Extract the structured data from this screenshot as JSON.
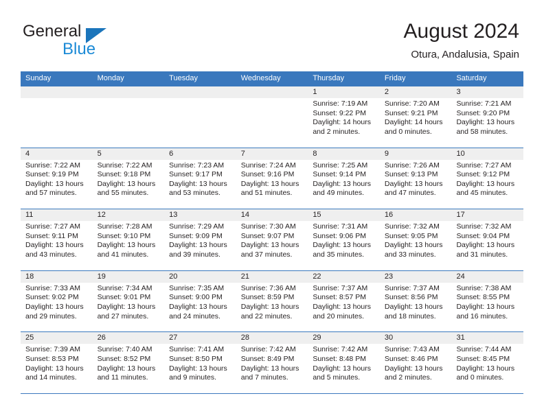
{
  "brand": {
    "name_part1": "General",
    "name_part2": "Blue",
    "triangle_color": "#1b75bb",
    "blue_text_color": "#1b8ad6"
  },
  "header": {
    "title": "August 2024",
    "subtitle": "Otura, Andalusia, Spain"
  },
  "theme": {
    "header_row_bg": "#3a78bd",
    "daynum_band_bg": "#efefef",
    "grid_line": "#3a78bd",
    "text": "#231f20"
  },
  "weekdays": [
    "Sunday",
    "Monday",
    "Tuesday",
    "Wednesday",
    "Thursday",
    "Friday",
    "Saturday"
  ],
  "weeks": [
    [
      {
        "day": "",
        "sunrise": "",
        "sunset": "",
        "daylight_line1": "",
        "daylight_line2": ""
      },
      {
        "day": "",
        "sunrise": "",
        "sunset": "",
        "daylight_line1": "",
        "daylight_line2": ""
      },
      {
        "day": "",
        "sunrise": "",
        "sunset": "",
        "daylight_line1": "",
        "daylight_line2": ""
      },
      {
        "day": "",
        "sunrise": "",
        "sunset": "",
        "daylight_line1": "",
        "daylight_line2": ""
      },
      {
        "day": "1",
        "sunrise": "Sunrise: 7:19 AM",
        "sunset": "Sunset: 9:22 PM",
        "daylight_line1": "Daylight: 14 hours",
        "daylight_line2": "and 2 minutes."
      },
      {
        "day": "2",
        "sunrise": "Sunrise: 7:20 AM",
        "sunset": "Sunset: 9:21 PM",
        "daylight_line1": "Daylight: 14 hours",
        "daylight_line2": "and 0 minutes."
      },
      {
        "day": "3",
        "sunrise": "Sunrise: 7:21 AM",
        "sunset": "Sunset: 9:20 PM",
        "daylight_line1": "Daylight: 13 hours",
        "daylight_line2": "and 58 minutes."
      }
    ],
    [
      {
        "day": "4",
        "sunrise": "Sunrise: 7:22 AM",
        "sunset": "Sunset: 9:19 PM",
        "daylight_line1": "Daylight: 13 hours",
        "daylight_line2": "and 57 minutes."
      },
      {
        "day": "5",
        "sunrise": "Sunrise: 7:22 AM",
        "sunset": "Sunset: 9:18 PM",
        "daylight_line1": "Daylight: 13 hours",
        "daylight_line2": "and 55 minutes."
      },
      {
        "day": "6",
        "sunrise": "Sunrise: 7:23 AM",
        "sunset": "Sunset: 9:17 PM",
        "daylight_line1": "Daylight: 13 hours",
        "daylight_line2": "and 53 minutes."
      },
      {
        "day": "7",
        "sunrise": "Sunrise: 7:24 AM",
        "sunset": "Sunset: 9:16 PM",
        "daylight_line1": "Daylight: 13 hours",
        "daylight_line2": "and 51 minutes."
      },
      {
        "day": "8",
        "sunrise": "Sunrise: 7:25 AM",
        "sunset": "Sunset: 9:14 PM",
        "daylight_line1": "Daylight: 13 hours",
        "daylight_line2": "and 49 minutes."
      },
      {
        "day": "9",
        "sunrise": "Sunrise: 7:26 AM",
        "sunset": "Sunset: 9:13 PM",
        "daylight_line1": "Daylight: 13 hours",
        "daylight_line2": "and 47 minutes."
      },
      {
        "day": "10",
        "sunrise": "Sunrise: 7:27 AM",
        "sunset": "Sunset: 9:12 PM",
        "daylight_line1": "Daylight: 13 hours",
        "daylight_line2": "and 45 minutes."
      }
    ],
    [
      {
        "day": "11",
        "sunrise": "Sunrise: 7:27 AM",
        "sunset": "Sunset: 9:11 PM",
        "daylight_line1": "Daylight: 13 hours",
        "daylight_line2": "and 43 minutes."
      },
      {
        "day": "12",
        "sunrise": "Sunrise: 7:28 AM",
        "sunset": "Sunset: 9:10 PM",
        "daylight_line1": "Daylight: 13 hours",
        "daylight_line2": "and 41 minutes."
      },
      {
        "day": "13",
        "sunrise": "Sunrise: 7:29 AM",
        "sunset": "Sunset: 9:09 PM",
        "daylight_line1": "Daylight: 13 hours",
        "daylight_line2": "and 39 minutes."
      },
      {
        "day": "14",
        "sunrise": "Sunrise: 7:30 AM",
        "sunset": "Sunset: 9:07 PM",
        "daylight_line1": "Daylight: 13 hours",
        "daylight_line2": "and 37 minutes."
      },
      {
        "day": "15",
        "sunrise": "Sunrise: 7:31 AM",
        "sunset": "Sunset: 9:06 PM",
        "daylight_line1": "Daylight: 13 hours",
        "daylight_line2": "and 35 minutes."
      },
      {
        "day": "16",
        "sunrise": "Sunrise: 7:32 AM",
        "sunset": "Sunset: 9:05 PM",
        "daylight_line1": "Daylight: 13 hours",
        "daylight_line2": "and 33 minutes."
      },
      {
        "day": "17",
        "sunrise": "Sunrise: 7:32 AM",
        "sunset": "Sunset: 9:04 PM",
        "daylight_line1": "Daylight: 13 hours",
        "daylight_line2": "and 31 minutes."
      }
    ],
    [
      {
        "day": "18",
        "sunrise": "Sunrise: 7:33 AM",
        "sunset": "Sunset: 9:02 PM",
        "daylight_line1": "Daylight: 13 hours",
        "daylight_line2": "and 29 minutes."
      },
      {
        "day": "19",
        "sunrise": "Sunrise: 7:34 AM",
        "sunset": "Sunset: 9:01 PM",
        "daylight_line1": "Daylight: 13 hours",
        "daylight_line2": "and 27 minutes."
      },
      {
        "day": "20",
        "sunrise": "Sunrise: 7:35 AM",
        "sunset": "Sunset: 9:00 PM",
        "daylight_line1": "Daylight: 13 hours",
        "daylight_line2": "and 24 minutes."
      },
      {
        "day": "21",
        "sunrise": "Sunrise: 7:36 AM",
        "sunset": "Sunset: 8:59 PM",
        "daylight_line1": "Daylight: 13 hours",
        "daylight_line2": "and 22 minutes."
      },
      {
        "day": "22",
        "sunrise": "Sunrise: 7:37 AM",
        "sunset": "Sunset: 8:57 PM",
        "daylight_line1": "Daylight: 13 hours",
        "daylight_line2": "and 20 minutes."
      },
      {
        "day": "23",
        "sunrise": "Sunrise: 7:37 AM",
        "sunset": "Sunset: 8:56 PM",
        "daylight_line1": "Daylight: 13 hours",
        "daylight_line2": "and 18 minutes."
      },
      {
        "day": "24",
        "sunrise": "Sunrise: 7:38 AM",
        "sunset": "Sunset: 8:55 PM",
        "daylight_line1": "Daylight: 13 hours",
        "daylight_line2": "and 16 minutes."
      }
    ],
    [
      {
        "day": "25",
        "sunrise": "Sunrise: 7:39 AM",
        "sunset": "Sunset: 8:53 PM",
        "daylight_line1": "Daylight: 13 hours",
        "daylight_line2": "and 14 minutes."
      },
      {
        "day": "26",
        "sunrise": "Sunrise: 7:40 AM",
        "sunset": "Sunset: 8:52 PM",
        "daylight_line1": "Daylight: 13 hours",
        "daylight_line2": "and 11 minutes."
      },
      {
        "day": "27",
        "sunrise": "Sunrise: 7:41 AM",
        "sunset": "Sunset: 8:50 PM",
        "daylight_line1": "Daylight: 13 hours",
        "daylight_line2": "and 9 minutes."
      },
      {
        "day": "28",
        "sunrise": "Sunrise: 7:42 AM",
        "sunset": "Sunset: 8:49 PM",
        "daylight_line1": "Daylight: 13 hours",
        "daylight_line2": "and 7 minutes."
      },
      {
        "day": "29",
        "sunrise": "Sunrise: 7:42 AM",
        "sunset": "Sunset: 8:48 PM",
        "daylight_line1": "Daylight: 13 hours",
        "daylight_line2": "and 5 minutes."
      },
      {
        "day": "30",
        "sunrise": "Sunrise: 7:43 AM",
        "sunset": "Sunset: 8:46 PM",
        "daylight_line1": "Daylight: 13 hours",
        "daylight_line2": "and 2 minutes."
      },
      {
        "day": "31",
        "sunrise": "Sunrise: 7:44 AM",
        "sunset": "Sunset: 8:45 PM",
        "daylight_line1": "Daylight: 13 hours",
        "daylight_line2": "and 0 minutes."
      }
    ]
  ]
}
